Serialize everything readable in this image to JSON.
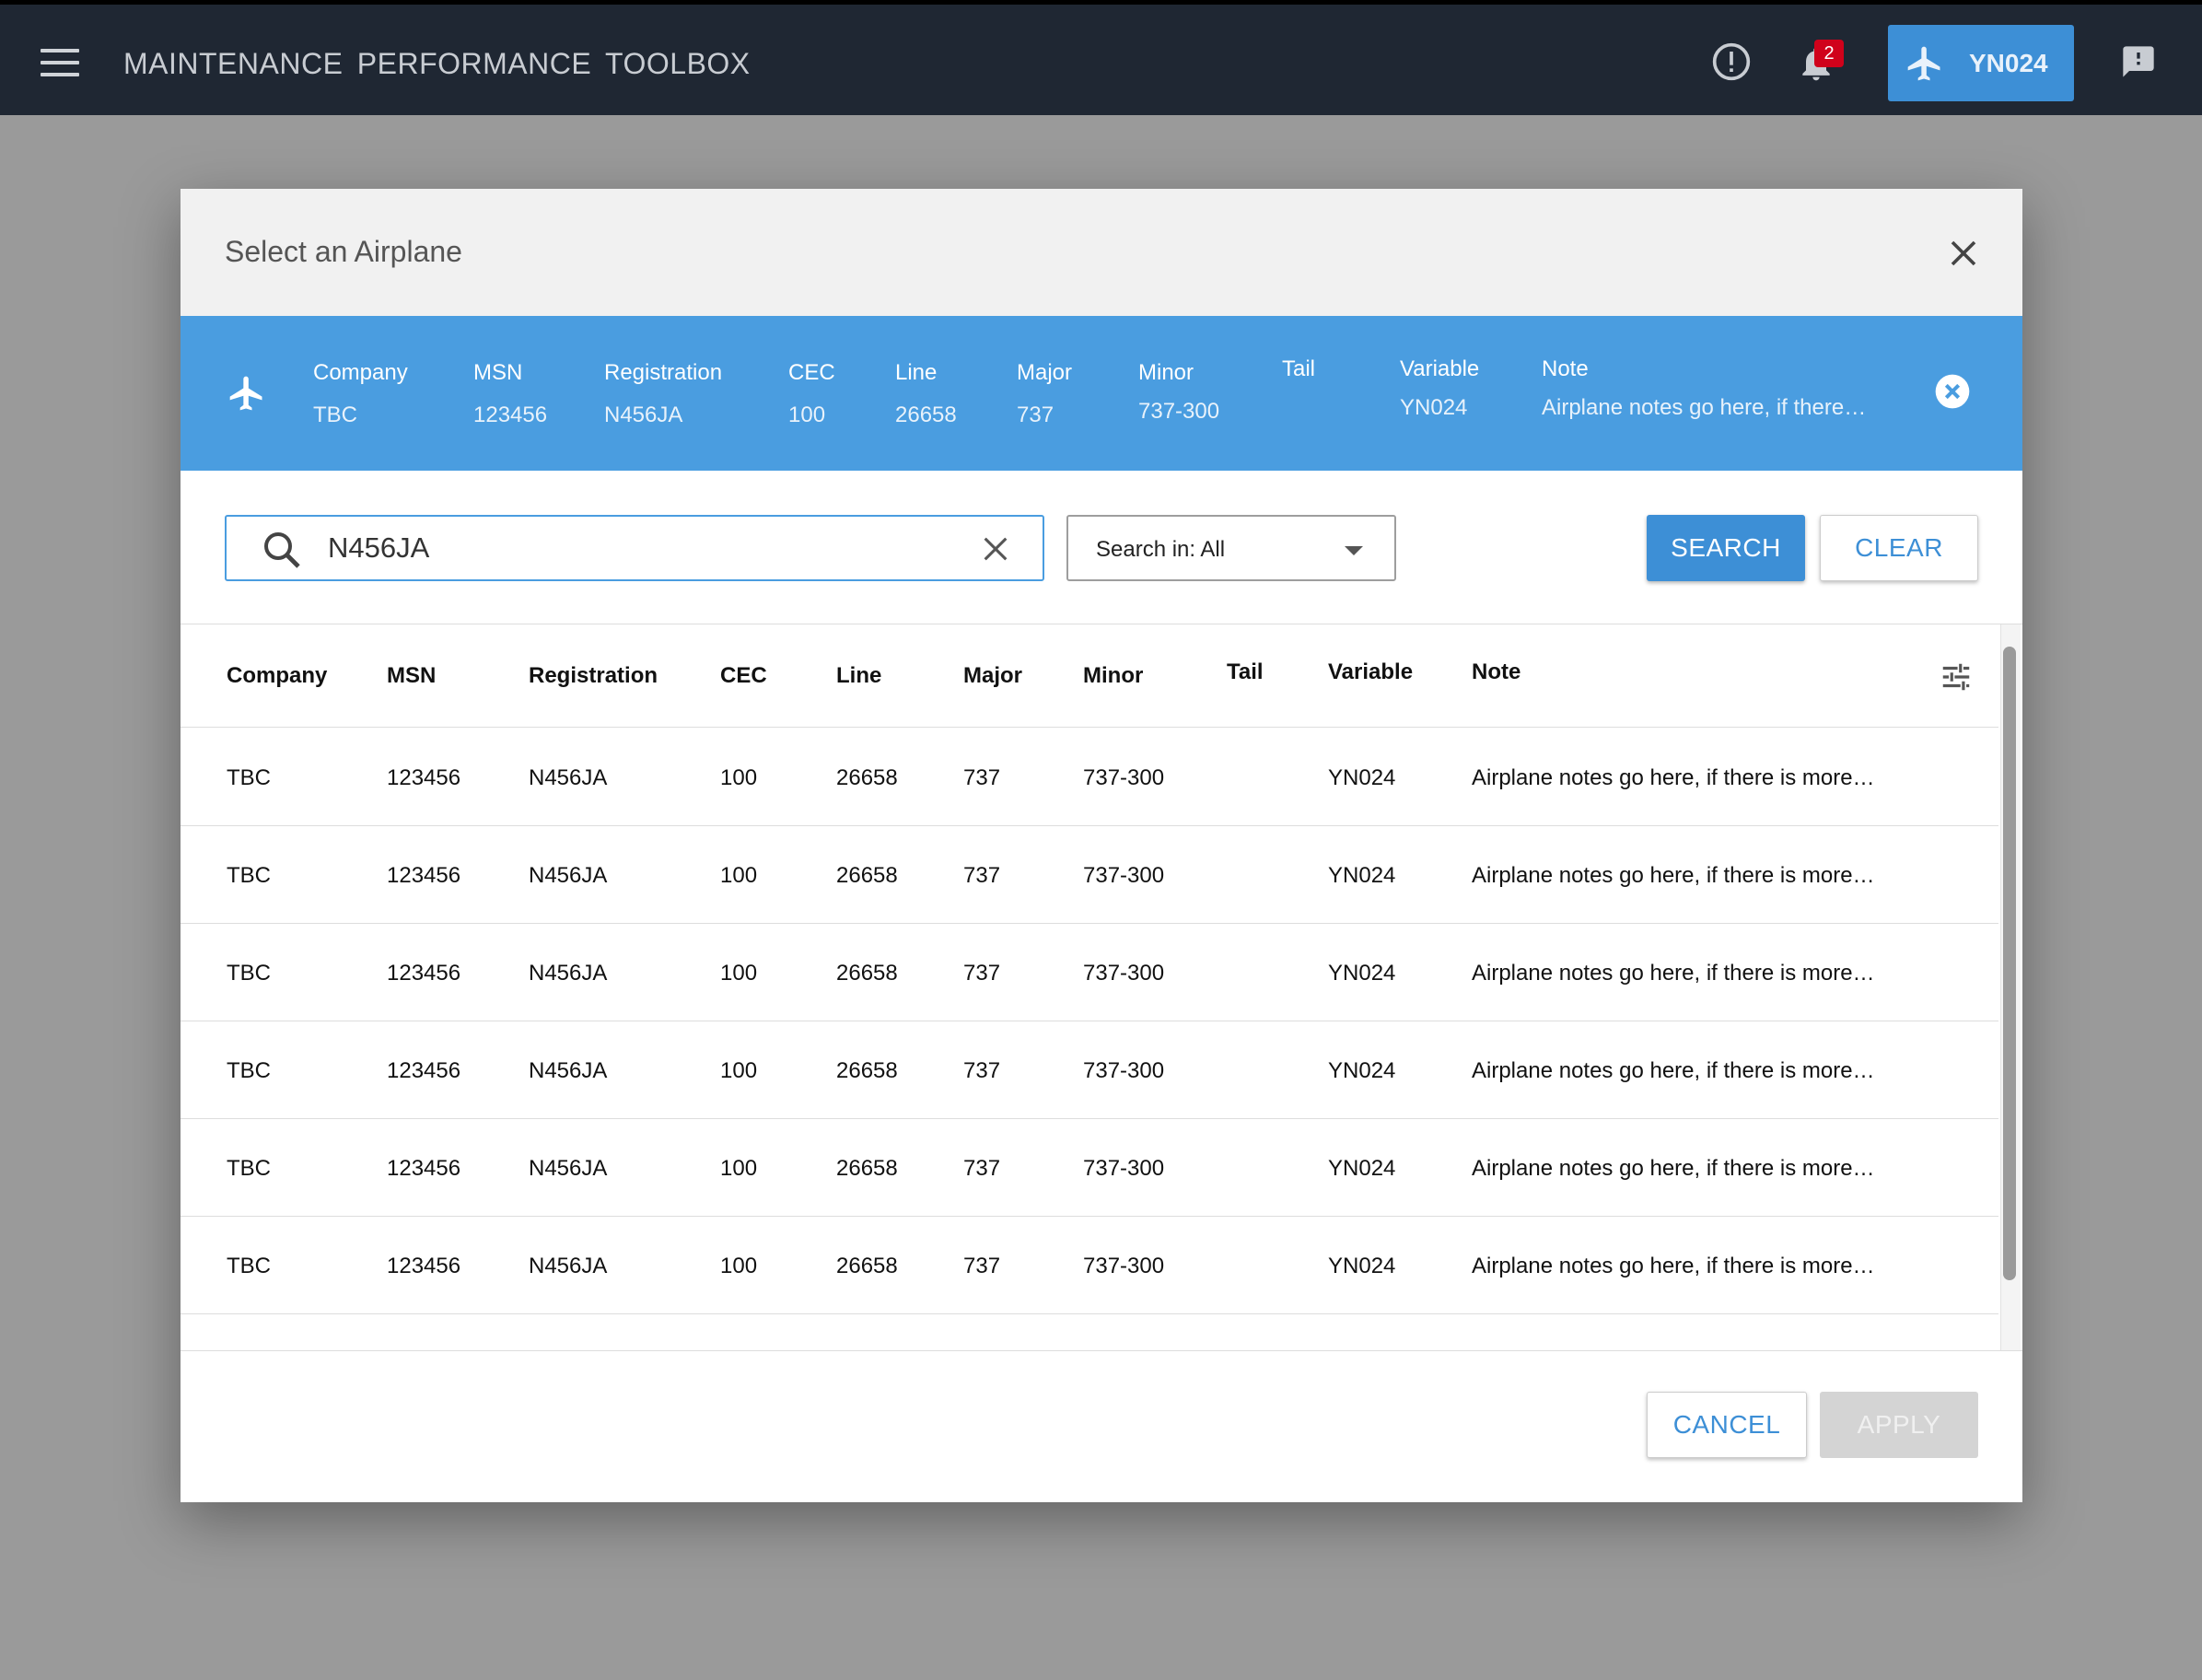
{
  "app": {
    "title": "MAINTENANCE PERFORMANCE  TOOLBOX",
    "notification_count": "2",
    "selected_plane_chip": "YN024"
  },
  "dialog": {
    "title": "Select an Airplane"
  },
  "selected": {
    "fields": [
      {
        "label": "Company",
        "value": "TBC"
      },
      {
        "label": "MSN",
        "value": "123456"
      },
      {
        "label": "Registration",
        "value": "N456JA"
      },
      {
        "label": "CEC",
        "value": "100"
      },
      {
        "label": "Line",
        "value": "26658"
      },
      {
        "label": "Major",
        "value": "737"
      },
      {
        "label": "Minor",
        "value": "737-300"
      },
      {
        "label": "Tail",
        "value": ""
      },
      {
        "label": "Variable",
        "value": "YN024"
      },
      {
        "label": "Note",
        "value": "Airplane notes go here, if there…"
      }
    ]
  },
  "search": {
    "value": "N456JA",
    "scope_label": "Search in: All",
    "search_label": "SEARCH",
    "clear_label": "CLEAR"
  },
  "table": {
    "columns": [
      "Company",
      "MSN",
      "Registration",
      "CEC",
      "Line",
      "Major",
      "Minor",
      "Tail",
      "Variable",
      "Note"
    ],
    "rows": [
      [
        "TBC",
        "123456",
        "N456JA",
        "100",
        "26658",
        "737",
        "737-300",
        "",
        "YN024",
        "Airplane notes go here, if there is more…"
      ],
      [
        "TBC",
        "123456",
        "N456JA",
        "100",
        "26658",
        "737",
        "737-300",
        "",
        "YN024",
        "Airplane notes go here, if there is more…"
      ],
      [
        "TBC",
        "123456",
        "N456JA",
        "100",
        "26658",
        "737",
        "737-300",
        "",
        "YN024",
        "Airplane notes go here, if there is more…"
      ],
      [
        "TBC",
        "123456",
        "N456JA",
        "100",
        "26658",
        "737",
        "737-300",
        "",
        "YN024",
        "Airplane notes go here, if there is more…"
      ],
      [
        "TBC",
        "123456",
        "N456JA",
        "100",
        "26658",
        "737",
        "737-300",
        "",
        "YN024",
        "Airplane notes go here, if there is more…"
      ],
      [
        "TBC",
        "123456",
        "N456JA",
        "100",
        "26658",
        "737",
        "737-300",
        "",
        "YN024",
        "Airplane notes go here, if there is more…"
      ]
    ]
  },
  "footer": {
    "cancel_label": "CANCEL",
    "apply_label": "APPLY"
  },
  "icons": {
    "menu": "hamburger-menu-icon",
    "alert": "alert-circle-icon",
    "bell": "bell-icon",
    "plane": "airplane-icon",
    "feedback": "feedback-icon",
    "close": "close-icon",
    "search": "search-icon",
    "clear": "clear-circle-icon",
    "settings": "column-settings-icon"
  },
  "colors": {
    "topbar": "#1f2733",
    "accent": "#3d8fd6",
    "selected_bar": "#4a9de0",
    "badge": "#d0021b"
  }
}
